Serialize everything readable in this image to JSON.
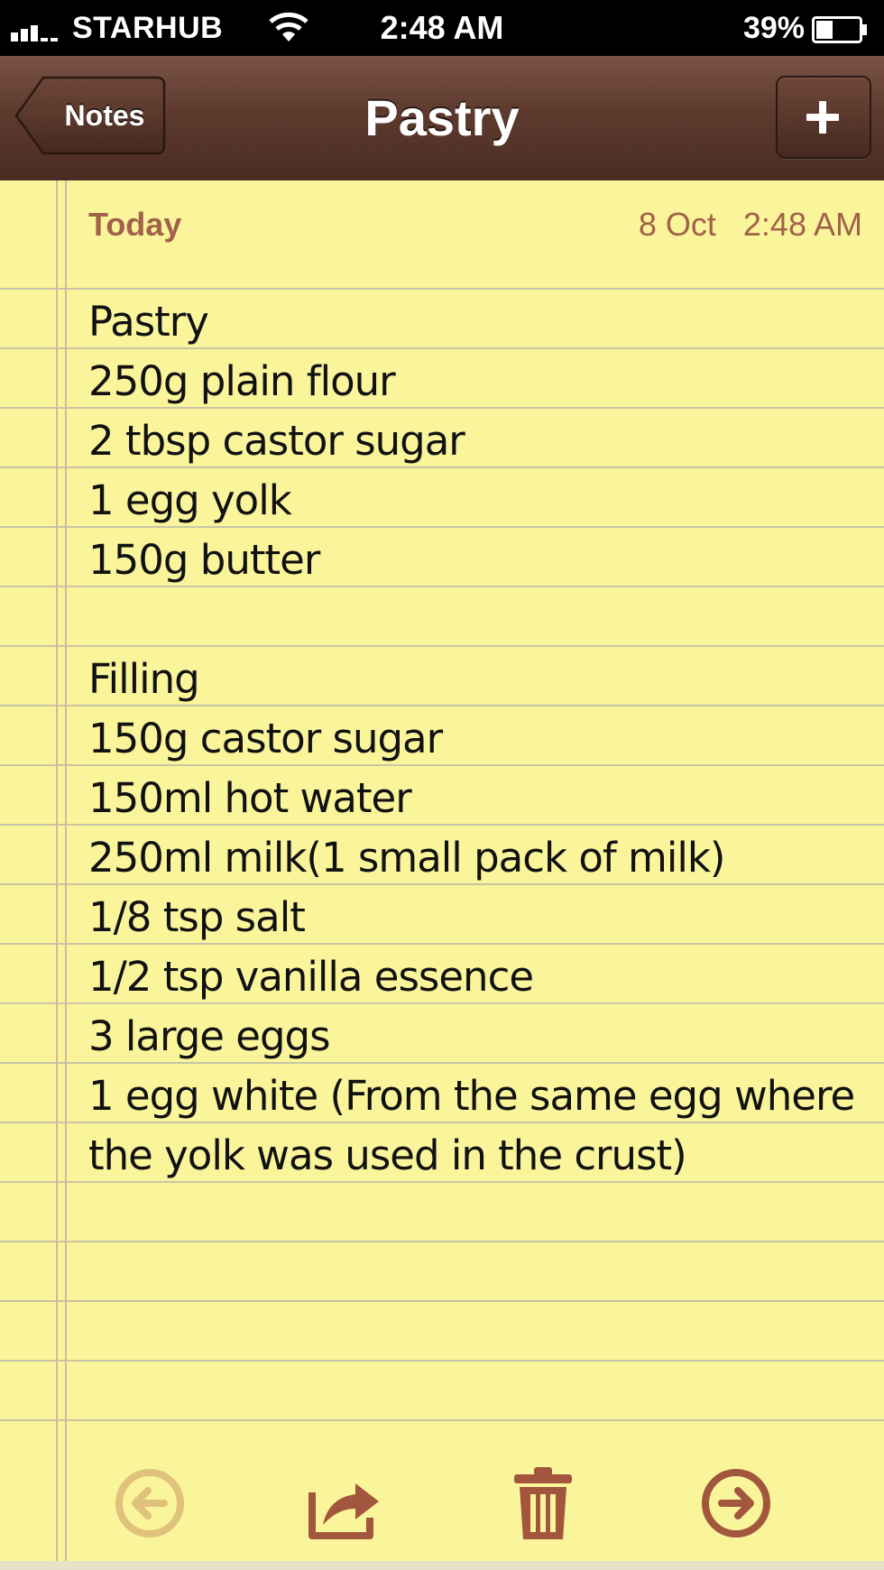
{
  "status_bar": {
    "carrier": "STARHUB",
    "time": "2:48 AM",
    "battery_percent": "39%",
    "battery_level": 0.39
  },
  "nav": {
    "back_label": "Notes",
    "title": "Pastry"
  },
  "note": {
    "date_label": "Today",
    "date": "8 Oct",
    "time": "2:48 AM",
    "lines": [
      "Pastry",
      "250g plain flour",
      "2 tbsp castor sugar",
      "1 egg yolk",
      "150g butter",
      "",
      "Filling",
      "150g castor sugar",
      "150ml hot water",
      "250ml milk(1 small pack of milk)",
      "1/8 tsp salt",
      "1/2 tsp vanilla essence",
      "3 large eggs",
      "1 egg white (From the same egg where",
      "the yolk was used in the crust)"
    ]
  },
  "colors": {
    "paper": "#faf59a",
    "nav_brown": "#5e3a2e",
    "accent_brown": "#a2614a",
    "ink": "#111111"
  },
  "toolbar": {
    "icons": [
      "previous-arrow-icon",
      "share-icon",
      "trash-icon",
      "next-arrow-icon"
    ]
  }
}
